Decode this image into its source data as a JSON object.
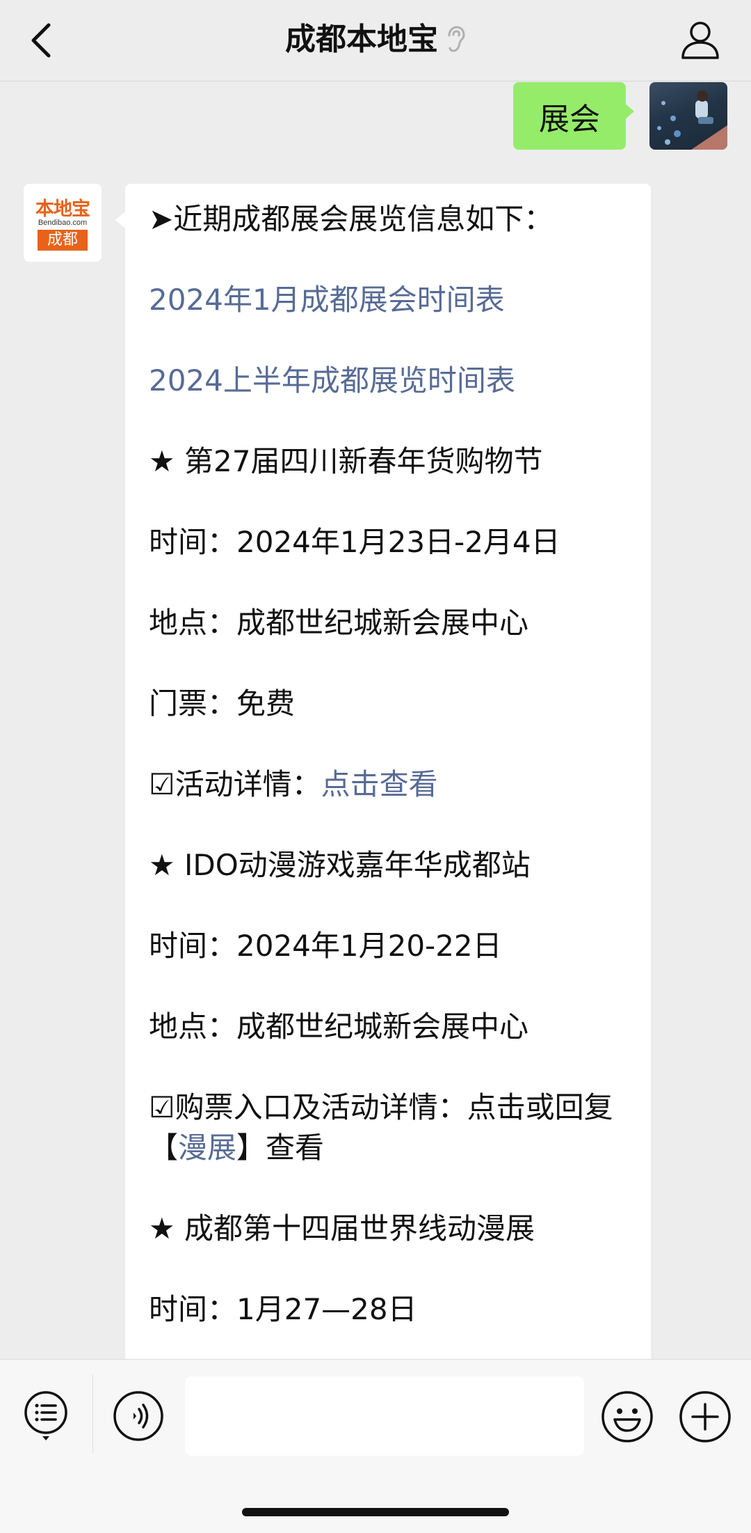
{
  "header": {
    "title": "成都本地宝",
    "back_icon": "chevron-left-icon",
    "mute_icon": "ear-icon",
    "profile_icon": "person-icon"
  },
  "sent_message": {
    "text": "展会"
  },
  "bot_avatar": {
    "line1": "本地宝",
    "line2": "Bendibao.com",
    "line3": "成都"
  },
  "received_message": {
    "intro": "➤近期成都展会展览信息如下：",
    "link1": "2024年1月成都展会时间表",
    "link2": "2024上半年成都展览时间表",
    "event1": {
      "title": "★ 第27届四川新春年货购物节",
      "time": "时间：2024年1月23日-2月4日",
      "place": "地点：成都世纪城新会展中心",
      "ticket": "门票：免费",
      "details_label": "☑活动详情：",
      "details_link": "点击查看"
    },
    "event2": {
      "title": "★ IDO动漫游戏嘉年华成都站",
      "time": "时间：2024年1月20-22日",
      "place": "地点：成都世纪城新会展中心",
      "ticket_prefix": "☑购票入口及活动详情：点击或回复【",
      "ticket_link": "漫展",
      "ticket_suffix": "】查看"
    },
    "event3": {
      "title": "★ 成都第十四届世界线动漫展",
      "time": "时间：1月27—28日"
    }
  },
  "input_bar": {
    "menu_icon": "list-menu-icon",
    "voice_icon": "voice-icon",
    "emoji_icon": "smiley-icon",
    "plus_icon": "plus-icon",
    "text_value": ""
  },
  "colors": {
    "sent_bubble": "#95ec69",
    "link": "#576b95",
    "brand_orange": "#e8621a"
  }
}
